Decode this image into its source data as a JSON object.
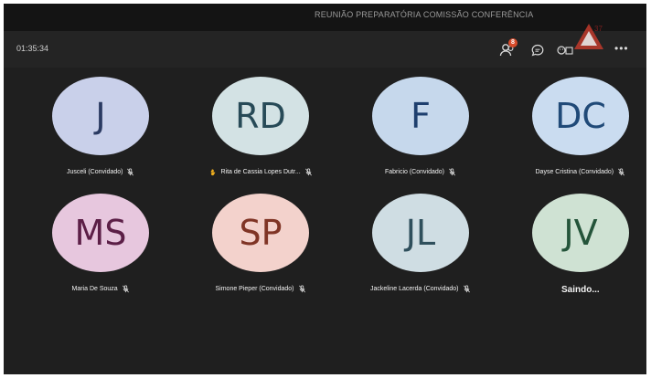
{
  "window": {
    "title": "REUNIÃO PREPARATÓRIA COMISSÃO CONFERÊNCIA"
  },
  "toolbar": {
    "timer": "01:35:34",
    "participants_badge": "8",
    "icons": [
      "participants-icon",
      "chat-icon",
      "reactions-icon",
      "more-options-icon"
    ],
    "more_label": "•••"
  },
  "participants": [
    {
      "initials": "J",
      "name": "Jusceli (Convidado)",
      "avatar_bg": "#c9d0ea",
      "initials_color": "#2a3a62",
      "muted": true,
      "hand_raised": false
    },
    {
      "initials": "RD",
      "name": "Rita de Cassia Lopes Dutr...",
      "avatar_bg": "#d3e2e4",
      "initials_color": "#274a57",
      "muted": true,
      "hand_raised": true
    },
    {
      "initials": "F",
      "name": "Fabricio (Convidado)",
      "avatar_bg": "#c6d8ec",
      "initials_color": "#1e3f6e",
      "muted": true,
      "hand_raised": false
    },
    {
      "initials": "DC",
      "name": "Dayse Cristina (Convidado)",
      "avatar_bg": "#cadcf0",
      "initials_color": "#204a78",
      "muted": true,
      "hand_raised": false
    },
    {
      "initials": "MS",
      "name": "Maria De Souza",
      "avatar_bg": "#e7c7de",
      "initials_color": "#5c1f47",
      "muted": true,
      "hand_raised": false
    },
    {
      "initials": "SP",
      "name": "Simone Pieper (Convidado)",
      "avatar_bg": "#f3d2cc",
      "initials_color": "#7f3425",
      "muted": true,
      "hand_raised": false
    },
    {
      "initials": "JL",
      "name": "Jackeline Lacerda (Convidado)",
      "avatar_bg": "#cfdde3",
      "initials_color": "#2f4f5c",
      "muted": true,
      "hand_raised": false
    },
    {
      "initials": "JV",
      "name": "Saindo...",
      "avatar_bg": "#cfe2d3",
      "initials_color": "#24543a",
      "muted": false,
      "hand_raised": false
    }
  ]
}
